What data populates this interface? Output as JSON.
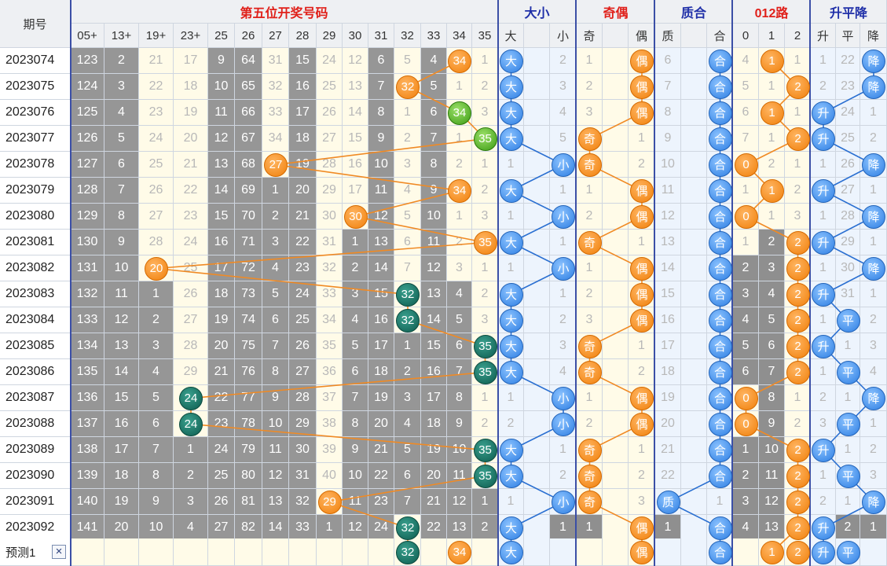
{
  "header": {
    "period_label": "期号",
    "groups": [
      {
        "label": "第五位开奖号码",
        "color": "#e0201a"
      },
      {
        "label": "大小",
        "color": "#1f2fa8"
      },
      {
        "label": "奇偶",
        "color": "#e0201a"
      },
      {
        "label": "质合",
        "color": "#1f2fa8"
      },
      {
        "label": "012路",
        "color": "#e0201a"
      },
      {
        "label": "升平降",
        "color": "#1f2fa8"
      }
    ],
    "columns": [
      "05+",
      "13+",
      "19+",
      "23+",
      "25",
      "26",
      "27",
      "28",
      "29",
      "30",
      "31",
      "32",
      "33",
      "34",
      "35",
      "大",
      "",
      "小",
      "奇",
      "",
      "偶",
      "质",
      "",
      "合",
      "0",
      "1",
      "2",
      "升",
      "平",
      "降"
    ]
  },
  "rows": [
    {
      "period": "2023074",
      "cells": [
        "123",
        "2",
        "21",
        "17",
        "9",
        "64",
        "31",
        "15",
        "24",
        "12",
        "6",
        "5",
        "4",
        "34",
        "1",
        "大",
        "",
        "2",
        "1",
        "",
        "偶",
        "6",
        "",
        "合",
        "4",
        "1",
        "1",
        "1",
        "22",
        "降"
      ]
    },
    {
      "period": "2023075",
      "cells": [
        "124",
        "3",
        "22",
        "18",
        "10",
        "65",
        "32",
        "16",
        "25",
        "13",
        "7",
        "32",
        "5",
        "1",
        "2",
        "大",
        "",
        "3",
        "2",
        "",
        "偶",
        "7",
        "",
        "合",
        "5",
        "1",
        "2",
        "2",
        "23",
        "降"
      ]
    },
    {
      "period": "2023076",
      "cells": [
        "125",
        "4",
        "23",
        "19",
        "11",
        "66",
        "33",
        "17",
        "26",
        "14",
        "8",
        "1",
        "6",
        "34",
        "3",
        "大",
        "",
        "4",
        "3",
        "",
        "偶",
        "8",
        "",
        "合",
        "6",
        "1",
        "1",
        "升",
        "24",
        "1"
      ]
    },
    {
      "period": "2023077",
      "cells": [
        "126",
        "5",
        "24",
        "20",
        "12",
        "67",
        "34",
        "18",
        "27",
        "15",
        "9",
        "2",
        "7",
        "1",
        "35",
        "大",
        "",
        "5",
        "奇",
        "",
        "1",
        "9",
        "",
        "合",
        "7",
        "1",
        "2",
        "升",
        "25",
        "2"
      ]
    },
    {
      "period": "2023078",
      "cells": [
        "127",
        "6",
        "25",
        "21",
        "13",
        "68",
        "27",
        "19",
        "28",
        "16",
        "10",
        "3",
        "8",
        "2",
        "1",
        "1",
        "",
        "小",
        "奇",
        "",
        "2",
        "10",
        "",
        "合",
        "0",
        "2",
        "1",
        "1",
        "26",
        "降"
      ]
    },
    {
      "period": "2023079",
      "cells": [
        "128",
        "7",
        "26",
        "22",
        "14",
        "69",
        "1",
        "20",
        "29",
        "17",
        "11",
        "4",
        "9",
        "34",
        "2",
        "大",
        "",
        "1",
        "1",
        "",
        "偶",
        "11",
        "",
        "合",
        "1",
        "1",
        "2",
        "升",
        "27",
        "1"
      ]
    },
    {
      "period": "2023080",
      "cells": [
        "129",
        "8",
        "27",
        "23",
        "15",
        "70",
        "2",
        "21",
        "30",
        "30",
        "12",
        "5",
        "10",
        "1",
        "3",
        "1",
        "",
        "小",
        "2",
        "",
        "偶",
        "12",
        "",
        "合",
        "0",
        "1",
        "3",
        "1",
        "28",
        "降"
      ]
    },
    {
      "period": "2023081",
      "cells": [
        "130",
        "9",
        "28",
        "24",
        "16",
        "71",
        "3",
        "22",
        "31",
        "1",
        "13",
        "6",
        "11",
        "2",
        "35",
        "大",
        "",
        "1",
        "奇",
        "",
        "1",
        "13",
        "",
        "合",
        "1",
        "2",
        "2",
        "升",
        "29",
        "1"
      ]
    },
    {
      "period": "2023082",
      "cells": [
        "131",
        "10",
        "20",
        "25",
        "17",
        "72",
        "4",
        "23",
        "32",
        "2",
        "14",
        "7",
        "12",
        "3",
        "1",
        "1",
        "",
        "小",
        "1",
        "",
        "偶",
        "14",
        "",
        "合",
        "2",
        "3",
        "2",
        "1",
        "30",
        "降"
      ]
    },
    {
      "period": "2023083",
      "cells": [
        "132",
        "11",
        "1",
        "26",
        "18",
        "73",
        "5",
        "24",
        "33",
        "3",
        "15",
        "32",
        "13",
        "4",
        "2",
        "大",
        "",
        "1",
        "2",
        "",
        "偶",
        "15",
        "",
        "合",
        "3",
        "4",
        "2",
        "升",
        "31",
        "1"
      ]
    },
    {
      "period": "2023084",
      "cells": [
        "133",
        "12",
        "2",
        "27",
        "19",
        "74",
        "6",
        "25",
        "34",
        "4",
        "16",
        "32",
        "14",
        "5",
        "3",
        "大",
        "",
        "2",
        "3",
        "",
        "偶",
        "16",
        "",
        "合",
        "4",
        "5",
        "2",
        "1",
        "平",
        "2"
      ]
    },
    {
      "period": "2023085",
      "cells": [
        "134",
        "13",
        "3",
        "28",
        "20",
        "75",
        "7",
        "26",
        "35",
        "5",
        "17",
        "1",
        "15",
        "6",
        "35",
        "大",
        "",
        "3",
        "奇",
        "",
        "1",
        "17",
        "",
        "合",
        "5",
        "6",
        "2",
        "升",
        "1",
        "3"
      ]
    },
    {
      "period": "2023086",
      "cells": [
        "135",
        "14",
        "4",
        "29",
        "21",
        "76",
        "8",
        "27",
        "36",
        "6",
        "18",
        "2",
        "16",
        "7",
        "35",
        "大",
        "",
        "4",
        "奇",
        "",
        "2",
        "18",
        "",
        "合",
        "6",
        "7",
        "2",
        "1",
        "平",
        "4"
      ]
    },
    {
      "period": "2023087",
      "cells": [
        "136",
        "15",
        "5",
        "24",
        "22",
        "77",
        "9",
        "28",
        "37",
        "7",
        "19",
        "3",
        "17",
        "8",
        "1",
        "1",
        "",
        "小",
        "1",
        "",
        "偶",
        "19",
        "",
        "合",
        "0",
        "8",
        "1",
        "2",
        "1",
        "降"
      ]
    },
    {
      "period": "2023088",
      "cells": [
        "137",
        "16",
        "6",
        "24",
        "23",
        "78",
        "10",
        "29",
        "38",
        "8",
        "20",
        "4",
        "18",
        "9",
        "2",
        "2",
        "",
        "小",
        "2",
        "",
        "偶",
        "20",
        "",
        "合",
        "0",
        "9",
        "2",
        "3",
        "平",
        "1"
      ]
    },
    {
      "period": "2023089",
      "cells": [
        "138",
        "17",
        "7",
        "1",
        "24",
        "79",
        "11",
        "30",
        "39",
        "9",
        "21",
        "5",
        "19",
        "10",
        "35",
        "大",
        "",
        "1",
        "奇",
        "",
        "1",
        "21",
        "",
        "合",
        "1",
        "10",
        "2",
        "升",
        "1",
        "2"
      ]
    },
    {
      "period": "2023090",
      "cells": [
        "139",
        "18",
        "8",
        "2",
        "25",
        "80",
        "12",
        "31",
        "40",
        "10",
        "22",
        "6",
        "20",
        "11",
        "35",
        "大",
        "",
        "2",
        "奇",
        "",
        "2",
        "22",
        "",
        "合",
        "2",
        "11",
        "2",
        "1",
        "平",
        "3"
      ]
    },
    {
      "period": "2023091",
      "cells": [
        "140",
        "19",
        "9",
        "3",
        "26",
        "81",
        "13",
        "32",
        "29",
        "11",
        "23",
        "7",
        "21",
        "12",
        "1",
        "1",
        "",
        "小",
        "奇",
        "",
        "3",
        "质",
        "",
        "1",
        "3",
        "12",
        "2",
        "2",
        "1",
        "降"
      ]
    },
    {
      "period": "2023092",
      "cells": [
        "141",
        "20",
        "10",
        "4",
        "27",
        "82",
        "14",
        "33",
        "1",
        "12",
        "24",
        "32",
        "22",
        "13",
        "2",
        "大",
        "",
        "1",
        "1",
        "",
        "偶",
        "1",
        "",
        "合",
        "4",
        "13",
        "2",
        "升",
        "2",
        "1"
      ]
    }
  ],
  "prediction": {
    "label": "预测1",
    "close_icon": "×",
    "cells": [
      "",
      "",
      "",
      "",
      "",
      "",
      "",
      "",
      "",
      "",
      "",
      "32",
      "",
      "34",
      "",
      "大",
      "",
      "",
      "",
      "",
      "偶",
      "",
      "",
      "合",
      "",
      "1",
      "2",
      "升",
      "平",
      ""
    ]
  },
  "colors": {
    "orange": "#f07f0a",
    "blue": "#2c7de2",
    "green": "#3a9a12",
    "teal": "#0d5b4e",
    "gray_cell": "#969696",
    "cream_cell": "#fffbe8",
    "blue_cell": "#edf4fd",
    "line_orange": "#f08a24",
    "line_blue": "#2a6fd1",
    "separator": "#3b4fa6"
  }
}
